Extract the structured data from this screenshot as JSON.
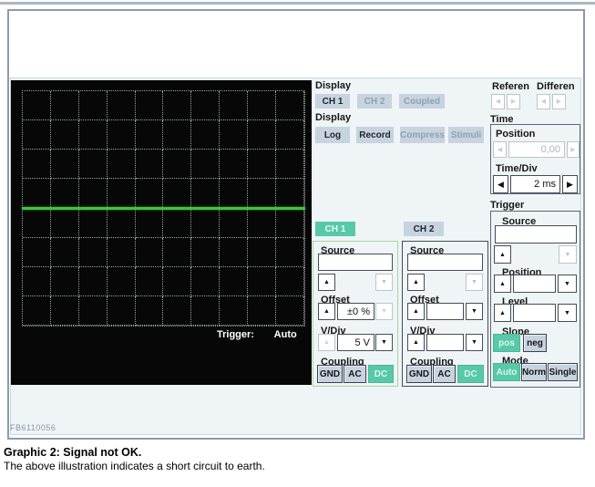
{
  "icons": {
    "left": "◀",
    "right": "▶",
    "up": "▲",
    "down": "▼"
  },
  "colors": {
    "accent_teal": "#57c9a9",
    "button_bg": "#c7d3df",
    "trace_green": "#3fc53f",
    "scope_bg": "#070707",
    "top_line": "#a9b6c4",
    "disabled_text": "#8fa0b0"
  },
  "app": {
    "display_ch": {
      "label": "Display",
      "buttons": [
        {
          "label": "CH 1",
          "enabled": true
        },
        {
          "label": "CH 2",
          "enabled": false
        },
        {
          "label": "Coupled",
          "enabled": false
        }
      ]
    },
    "display_mode": {
      "label": "Display",
      "buttons": [
        {
          "label": "Log",
          "enabled": true
        },
        {
          "label": "Record",
          "enabled": true
        },
        {
          "label": "Compress",
          "enabled": false
        },
        {
          "label": "Stimuli",
          "enabled": false
        }
      ]
    },
    "reference": {
      "label": "Referen"
    },
    "difference": {
      "label": "Differen"
    },
    "time": {
      "label": "Time",
      "position": {
        "label": "Position",
        "value": "0,00"
      },
      "time_div": {
        "label": "Time/Div",
        "value": "2 ms"
      }
    },
    "trigger": {
      "label": "Trigger",
      "source_label": "Source",
      "source_value": "",
      "position_label": "Position",
      "position_value": "",
      "level_label": "Level",
      "level_value": "",
      "slope_label": "Slope",
      "slope_buttons": [
        {
          "label": "pos",
          "active": true
        },
        {
          "label": "neg",
          "active": false
        }
      ],
      "mode_label": "Mode",
      "mode_buttons": [
        {
          "label": "Auto",
          "active": true
        },
        {
          "label": "Norm",
          "active": false
        },
        {
          "label": "Single",
          "active": false
        }
      ]
    },
    "ch1": {
      "button_label": "CH 1",
      "active": true,
      "source_label": "Source",
      "source_value": "",
      "offset_label": "Offset",
      "offset_value": "±0 %",
      "vdiv_label": "V/Div",
      "vdiv_value": "5 V",
      "coupling_label": "Coupling",
      "coupling_buttons": [
        {
          "label": "GND",
          "active": false
        },
        {
          "label": "AC",
          "active": false
        },
        {
          "label": "DC",
          "active": true
        }
      ]
    },
    "ch2": {
      "button_label": "CH 2",
      "active": false,
      "source_label": "Source",
      "source_value": "",
      "offset_label": "Offset",
      "offset_value": "",
      "vdiv_label": "V/Div",
      "vdiv_value": "",
      "coupling_label": "Coupling",
      "coupling_buttons": [
        {
          "label": "GND",
          "active": false
        },
        {
          "label": "AC",
          "active": false
        },
        {
          "label": "DC",
          "active": true
        }
      ]
    },
    "scope": {
      "grid": {
        "rows": 8,
        "cols": 10
      },
      "trace": {
        "type": "flat-line",
        "position": "center",
        "meaning": "0 V flat signal"
      },
      "trigger_status_label": "Trigger:",
      "trigger_status_value": "Auto"
    }
  },
  "footer": {
    "figure_code": "FB6110056"
  },
  "caption": {
    "title": "Graphic 2: Signal not OK.",
    "body": "The above illustration indicates a short circuit to earth."
  }
}
